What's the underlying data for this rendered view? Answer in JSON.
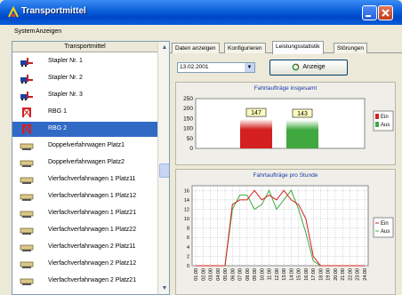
{
  "window": {
    "title": "Transportmittel"
  },
  "menu": {
    "items": [
      "System",
      "Anzeigen"
    ]
  },
  "tree": {
    "header": "Transportmittel",
    "items": [
      {
        "label": "Stapler Nr. 1",
        "icon": "forklift-icon",
        "selected": false
      },
      {
        "label": "Stapler Nr. 2",
        "icon": "forklift-icon",
        "selected": false
      },
      {
        "label": "Stapler Nr. 3",
        "icon": "forklift-icon",
        "selected": false
      },
      {
        "label": "RBG 1",
        "icon": "crane-icon",
        "selected": false
      },
      {
        "label": "RBG 2",
        "icon": "crane-icon",
        "selected": true
      },
      {
        "label": "Doppelverfahrwagen Platz1",
        "icon": "shuttle-icon",
        "selected": false
      },
      {
        "label": "Doppelverfahrwagen Platz2",
        "icon": "shuttle-icon",
        "selected": false
      },
      {
        "label": "Vierfachverfahrwagen 1 Platz11",
        "icon": "shuttle-icon",
        "selected": false
      },
      {
        "label": "Vierfachverfahrwagen 1 Platz12",
        "icon": "shuttle-icon",
        "selected": false
      },
      {
        "label": "Vierfachverfahrwagen 1 Platz21",
        "icon": "shuttle-icon",
        "selected": false
      },
      {
        "label": "Vierfachverfahrwagen 1 Platz22",
        "icon": "shuttle-icon",
        "selected": false
      },
      {
        "label": "Vierfachverfahrwagen 2 Platz11",
        "icon": "shuttle-icon",
        "selected": false
      },
      {
        "label": "Vierfachverfahrwagen 2 Platz12",
        "icon": "shuttle-icon",
        "selected": false
      },
      {
        "label": "Vierfachverfahrwagen 2 Platz21",
        "icon": "shuttle-icon",
        "selected": false
      }
    ]
  },
  "tabs": [
    "Daten anzeigen",
    "Konfigurieren",
    "Leistungsstatistik",
    "Störungen"
  ],
  "active_tab": 2,
  "controls": {
    "date": "13.02.2001",
    "show_button": "Anzeige"
  },
  "colors": {
    "ein": "#d42020",
    "aus": "#3fa83f",
    "title_blue": "#0a5fd8",
    "selection": "#316ac5"
  },
  "chart_data": [
    {
      "type": "bar",
      "title": "Fahrtaufträge insgesamt",
      "categories": [
        "Ein",
        "Aus"
      ],
      "values": [
        147,
        143
      ],
      "series": [
        {
          "name": "Ein",
          "values": [
            147
          ]
        },
        {
          "name": "Aus",
          "values": [
            143
          ]
        }
      ],
      "yticks": [
        "250",
        "200",
        "150",
        "100",
        "50",
        "0"
      ],
      "ylim": [
        0,
        250
      ],
      "legend": "right"
    },
    {
      "type": "line",
      "title": "Fahrtaufträge pro Stunde",
      "x": [
        "01:00",
        "02:00",
        "03:00",
        "04:00",
        "05:00",
        "06:00",
        "07:00",
        "08:00",
        "09:00",
        "10:00",
        "11:00",
        "12:00",
        "13:00",
        "14:00",
        "15:00",
        "16:00",
        "17:00",
        "18:00",
        "19:00",
        "20:00",
        "21:00",
        "22:00",
        "23:00",
        "24:00"
      ],
      "yticks": [
        "16",
        "14",
        "12",
        "10",
        "8",
        "6",
        "4",
        "2",
        "0"
      ],
      "ylim": [
        0,
        17
      ],
      "series": [
        {
          "name": "Ein",
          "values": [
            0,
            0,
            0,
            0,
            0,
            13,
            14,
            14,
            16,
            14,
            15,
            14,
            16,
            14,
            13,
            10,
            2,
            0,
            0,
            0,
            0,
            0,
            0,
            0
          ]
        },
        {
          "name": "Aus",
          "values": [
            0,
            0,
            0,
            0,
            0,
            12,
            15,
            15,
            12,
            13,
            16,
            12,
            14,
            16,
            12,
            7,
            1,
            0,
            0,
            0,
            0,
            0,
            0,
            0
          ]
        }
      ],
      "legend": "right",
      "grid": true
    }
  ]
}
